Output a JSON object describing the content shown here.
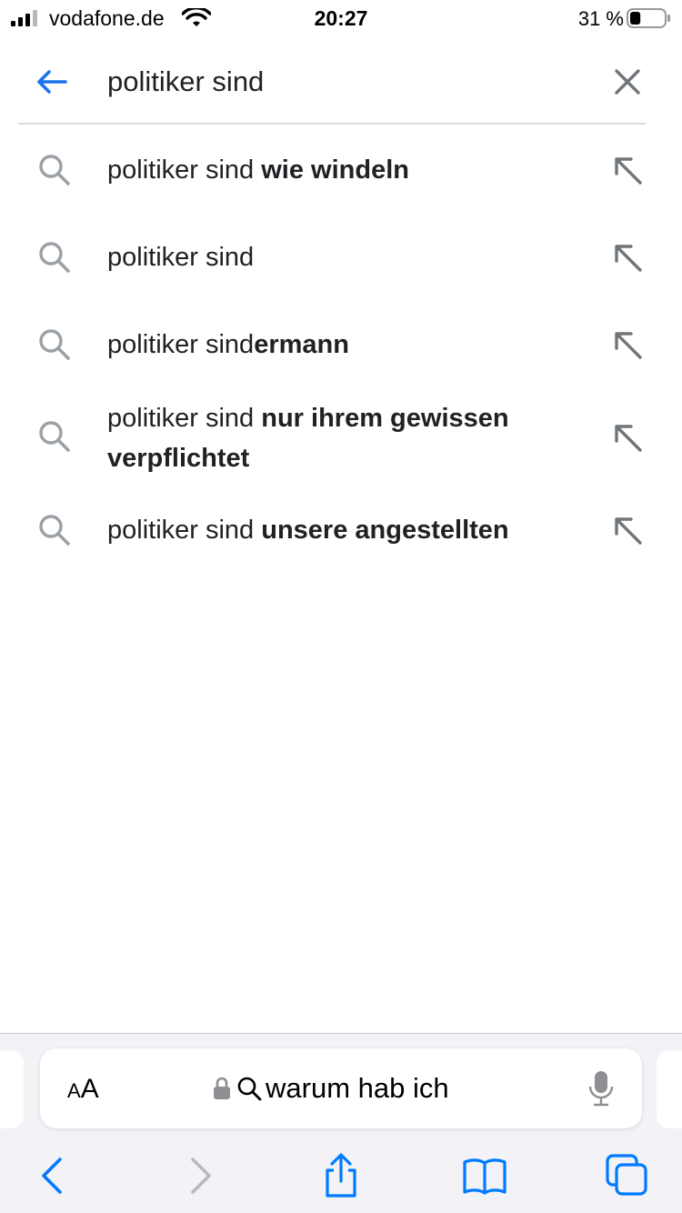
{
  "status_bar": {
    "carrier": "vodafone.de",
    "time": "20:27",
    "battery_percent": "31 %",
    "battery_level": 0.31
  },
  "search": {
    "query": "politiker sind",
    "back_icon": "arrow-left-icon",
    "clear_icon": "close-icon"
  },
  "suggestions": [
    {
      "prefix": "politiker sind ",
      "completion": "wie windeln"
    },
    {
      "prefix": "politiker sind",
      "completion": ""
    },
    {
      "prefix": "politiker sind",
      "completion": "ermann"
    },
    {
      "prefix": "politiker sind ",
      "completion": "nur ihrem gewissen verpflichtet"
    },
    {
      "prefix": "politiker sind ",
      "completion": "unsere angestellten"
    }
  ],
  "safari": {
    "aa_label_small": "A",
    "aa_label_large": "A",
    "url_text": "warum hab ich",
    "toolbar": [
      "back-icon",
      "forward-icon",
      "share-icon",
      "bookmarks-icon",
      "tabs-icon"
    ]
  },
  "colors": {
    "accent": "#1a73e8",
    "ios_blue": "#007aff",
    "icon_gray": "#70757a",
    "divider": "#dadce0"
  }
}
